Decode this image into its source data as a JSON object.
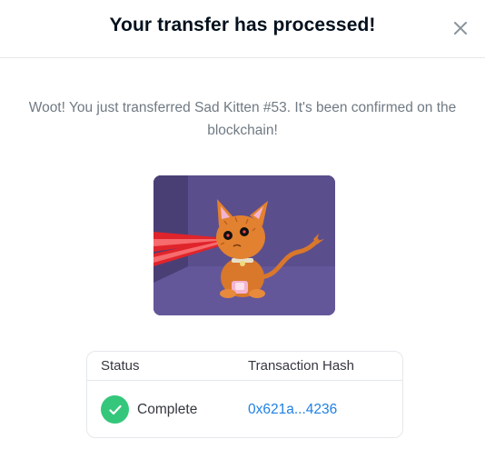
{
  "modal": {
    "title": "Your transfer has processed!",
    "close_icon": "close-icon",
    "message": "Woot! You just transferred Sad Kitten #53. It's been confirmed on the blockchain!"
  },
  "nft": {
    "name": "Sad Kitten #53",
    "background_color": "#5a4d88"
  },
  "table": {
    "headers": {
      "status": "Status",
      "hash": "Transaction Hash"
    },
    "row": {
      "status": "Complete",
      "status_icon": "check-circle-icon",
      "hash": "0x621a...4236"
    }
  },
  "colors": {
    "success": "#34c77b",
    "link": "#2081e2",
    "title": "#04111d",
    "muted": "#707a83"
  }
}
